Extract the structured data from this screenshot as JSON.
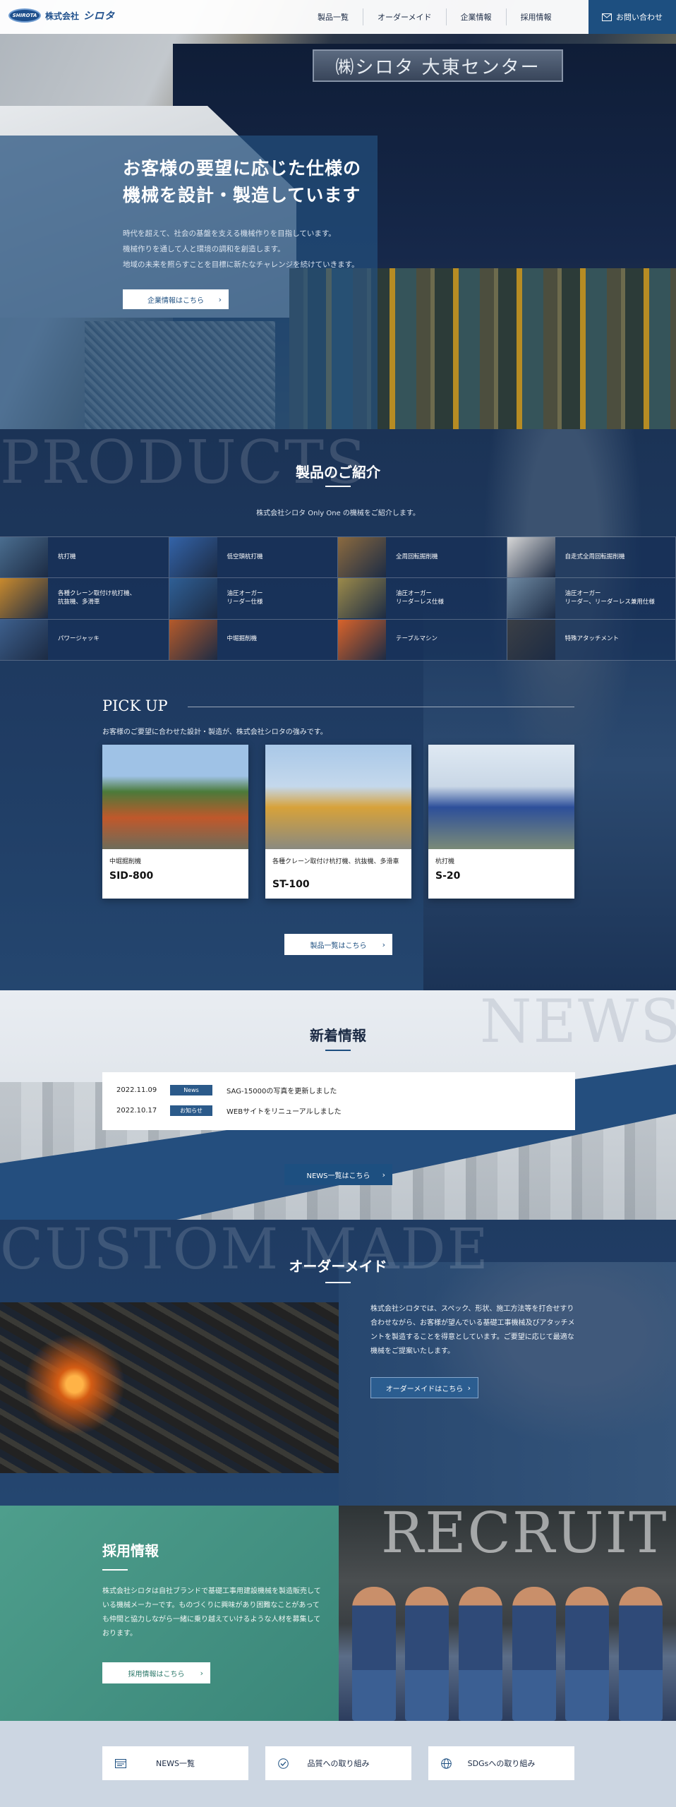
{
  "header": {
    "logo_mark": "SHIROTA",
    "logo_text": "株式会社",
    "logo_brand": "シロタ",
    "nav": [
      "製品一覧",
      "オーダーメイド",
      "企業情報",
      "採用情報"
    ],
    "contact": "お問い合わせ"
  },
  "hero": {
    "sign": "㈱シロタ 大東センター",
    "title_line1": "お客様の要望に応じた仕様の",
    "title_line2": "機械を設計・製造しています",
    "lines": [
      "時代を超えて、社会の基盤を支える機械作りを目指しています。",
      "機械作りを通して人と環境の調和を創造します。",
      "地域の未来を照らすことを目標に新たなチャレンジを続けていきます。"
    ],
    "button": "企業情報はこちら"
  },
  "products": {
    "ghost": "PRODUCTS",
    "title": "製品のご紹介",
    "subtitle": "株式会社シロタ Only One の機械をご紹介します。",
    "items": [
      {
        "label": "杭打機",
        "thumb": "#4a6d8f"
      },
      {
        "label": "低空頭杭打機",
        "thumb": "#3363a8"
      },
      {
        "label": "全周回転掘削機",
        "thumb": "#8b6a3f"
      },
      {
        "label": "自走式全周回転掘削機",
        "thumb": "#d8d8d8"
      },
      {
        "label": "各種クレーン取付け杭打機、\n抗抜機、多滑車",
        "thumb": "#c98a2d"
      },
      {
        "label": "油圧オーガー\nリーダー仕様",
        "thumb": "#2f5f95"
      },
      {
        "label": "油圧オーガー\nリーダーレス仕様",
        "thumb": "#9b8a4a"
      },
      {
        "label": "油圧オーガー\nリーダー、リーダーレス兼用仕様",
        "thumb": "#6f8aa3"
      },
      {
        "label": "パワージャッキ",
        "thumb": "#3d5f8c"
      },
      {
        "label": "中堀掘削機",
        "thumb": "#b55a2a"
      },
      {
        "label": "テーブルマシン",
        "thumb": "#d9632a"
      },
      {
        "label": "特殊アタッチメント",
        "thumb": "#3b3f45"
      }
    ]
  },
  "pickup": {
    "title": "PICK UP",
    "subtitle": "お客様のご要望に合わせた設計・製造が、株式会社シロタの強みです。",
    "cards": [
      {
        "category": "中堀掘削機",
        "model": "SID-800"
      },
      {
        "category": "各種クレーン取付け杭打機、抗抜機、多滑車",
        "model": "ST-100"
      },
      {
        "category": "杭打機",
        "model": "S-20"
      }
    ],
    "button": "製品一覧はこちら"
  },
  "news": {
    "ghost": "NEWS",
    "title": "新着情報",
    "items": [
      {
        "date": "2022.11.09",
        "tag": "News",
        "text": "SAG-15000の写真を更新しました"
      },
      {
        "date": "2022.10.17",
        "tag": "お知らせ",
        "text": "WEBサイトをリニューアルしました"
      }
    ],
    "button": "NEWS一覧はこちら"
  },
  "order": {
    "ghost": "CUSTOM MADE",
    "title": "オーダーメイド",
    "text": "株式会社シロタでは、スペック、形状、施工方法等を打合せすり合わせながら、お客様が望んでいる基礎工事機械及びアタッチメントを製造することを得意としています。ご要望に応じて最適な機械をご提案いたします。",
    "button": "オーダーメイドはこちら"
  },
  "recruit": {
    "ghost": "RECRUIT",
    "title": "採用情報",
    "text": "株式会社シロタは自社ブランドで基礎工事用建設機械を製造販売している機械メーカーです。ものづくりに興味があり困難なことがあっても仲間と協力しながら一緒に乗り越えていけるような人材を募集しております。",
    "button": "採用情報はこちら"
  },
  "footer_links": [
    {
      "label": "NEWS一覧",
      "icon": "news-icon"
    },
    {
      "label": "品質への取り組み",
      "icon": "check-circle-icon"
    },
    {
      "label": "SDGsへの取り組み",
      "icon": "globe-icon"
    }
  ],
  "colors": {
    "primary": "#1d4f80",
    "navy": "#1b3356",
    "teal": "#4e9e8c"
  }
}
